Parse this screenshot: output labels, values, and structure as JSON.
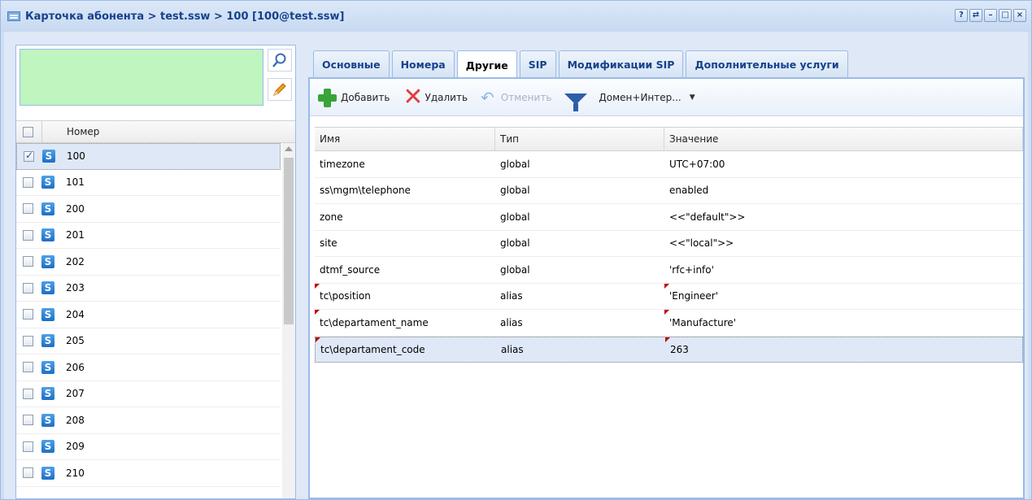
{
  "window": {
    "title": "Карточка абонента > test.ssw > 100 [100@test.ssw]",
    "tools": [
      "?",
      "⇄",
      "–",
      "□",
      "×"
    ]
  },
  "left": {
    "column_header": "Номер",
    "rows": [
      {
        "number": "100",
        "checked": true
      },
      {
        "number": "101",
        "checked": false
      },
      {
        "number": "200",
        "checked": false
      },
      {
        "number": "201",
        "checked": false
      },
      {
        "number": "202",
        "checked": false
      },
      {
        "number": "203",
        "checked": false
      },
      {
        "number": "204",
        "checked": false
      },
      {
        "number": "205",
        "checked": false
      },
      {
        "number": "206",
        "checked": false
      },
      {
        "number": "207",
        "checked": false
      },
      {
        "number": "208",
        "checked": false
      },
      {
        "number": "209",
        "checked": false
      },
      {
        "number": "210",
        "checked": false
      }
    ],
    "row_icon_letter": "S"
  },
  "tabs": [
    "Основные",
    "Номера",
    "Другие",
    "SIP",
    "Модификации SIP",
    "Дополнительные услуги"
  ],
  "active_tab": "Другие",
  "toolbar": {
    "add": "Добавить",
    "delete": "Удалить",
    "cancel": "Отменить",
    "filter": "Домен+Интер..."
  },
  "table": {
    "headers": [
      "Имя",
      "Тип",
      "Значение"
    ],
    "rows": [
      {
        "name": "timezone",
        "type": "global",
        "value": "UTC+07:00",
        "dirty": false
      },
      {
        "name": "ss\\mgm\\telephone",
        "type": "global",
        "value": "enabled",
        "dirty": false
      },
      {
        "name": "zone",
        "type": "global",
        "value": "<<\"default\">>",
        "dirty": false
      },
      {
        "name": "site",
        "type": "global",
        "value": "<<\"local\">>",
        "dirty": false
      },
      {
        "name": "dtmf_source",
        "type": "global",
        "value": "'rfc+info'",
        "dirty": false
      },
      {
        "name": "tc\\position",
        "type": "alias",
        "value": "'Engineer'",
        "dirty": true
      },
      {
        "name": "tc\\departament_name",
        "type": "alias",
        "value": "'Manufacture'",
        "dirty": true
      },
      {
        "name": "tc\\departament_code",
        "type": "alias",
        "value": "263",
        "dirty": true,
        "selected": true
      }
    ]
  }
}
